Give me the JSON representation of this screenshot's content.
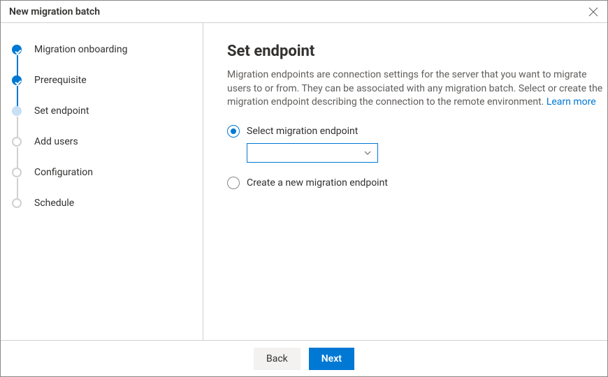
{
  "window": {
    "title": "New migration batch"
  },
  "steps": [
    {
      "label": "Migration onboarding"
    },
    {
      "label": "Prerequisite"
    },
    {
      "label": "Set endpoint"
    },
    {
      "label": "Add users"
    },
    {
      "label": "Configuration"
    },
    {
      "label": "Schedule"
    }
  ],
  "main": {
    "heading": "Set endpoint",
    "description": "Migration endpoints are connection settings for the server that you want to migrate users to or from. They can be associated with any migration batch. Select or create the migration endpoint describing the connection to the remote environment. ",
    "learn_more": "Learn more"
  },
  "options": {
    "select_label": "Select migration endpoint",
    "create_label": "Create a new migration endpoint",
    "selected_value": ""
  },
  "footer": {
    "back": "Back",
    "next": "Next"
  }
}
